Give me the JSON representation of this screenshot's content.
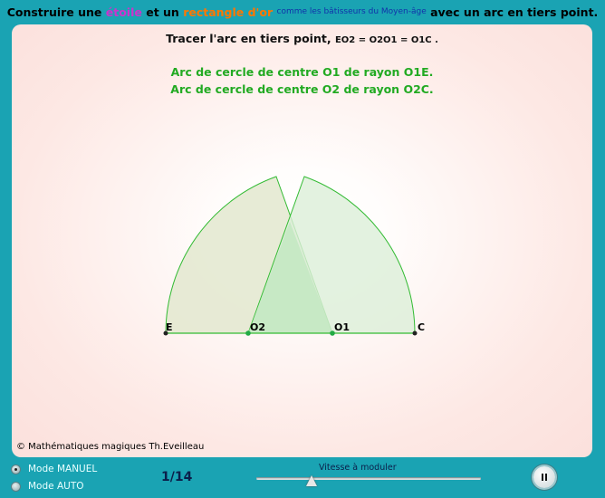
{
  "header": {
    "part1": "Construire une",
    "star": "étoile",
    "part2": "et un",
    "rectangle": "rectangle d'or",
    "part3": "comme les bâtisseurs du Moyen-âge",
    "part4": "avec un arc en tiers point."
  },
  "instruction": {
    "text": "Tracer l'arc en tiers point,",
    "equation": "EO2 = O2O1 = O1C ."
  },
  "arcs": {
    "line1": "Arc de cercle de centre O1 de rayon O1E.",
    "line2": "Arc de cercle de centre O2 de rayon O2C."
  },
  "points": {
    "E": "E",
    "O2": "O2",
    "O1": "O1",
    "C": "C"
  },
  "copyright": "© Mathématiques magiques Th.Eveilleau",
  "controls": {
    "mode_manual": "Mode MANUEL",
    "mode_auto": "Mode AUTO",
    "selected_mode": "Mode MANUEL",
    "page": "1/14",
    "speed_label": "Vitesse  à moduler"
  },
  "colors": {
    "frame": "#1aa3b3",
    "title_magenta": "#cc33cc",
    "title_orange": "#ff7700",
    "arc_text_green": "#22aa22",
    "figure_line": "#33bb33"
  }
}
